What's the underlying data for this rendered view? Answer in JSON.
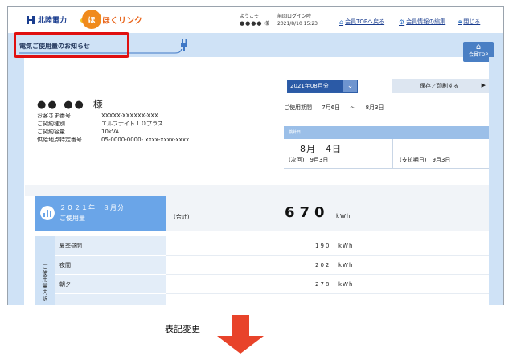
{
  "header": {
    "logo_company": "北陸電力",
    "logo_service": "ほくリンク",
    "welcome_label": "ようこそ",
    "user_name": "●●●●",
    "user_suffix": "様",
    "last_login_label": "前回ログイン時",
    "last_login_value": "2021/8/10 15:23",
    "links": [
      {
        "label": "会員TOPへ戻る",
        "icon": "home-icon"
      },
      {
        "label": "会員情報の編集",
        "icon": "gear-icon"
      },
      {
        "label": "閉じる",
        "icon": "lock-icon"
      }
    ]
  },
  "title_bar": {
    "title": "電気ご使用量のお知らせ",
    "top_button_label": "会員TOP"
  },
  "customer": {
    "name": "●● ●●",
    "honorific": "様",
    "fields": [
      {
        "key": "お客さま番号",
        "value": "XXXXX-XXXXXX-XXX"
      },
      {
        "key": "ご契約種別",
        "value": "エルフナイト１０プラス"
      },
      {
        "key": "ご契約容量",
        "value": "10kVA"
      },
      {
        "key": "供給地点特定番号",
        "value": "05-0000-0000- xxxx-xxxx-xxxx"
      }
    ]
  },
  "month_select": {
    "value": "2021年08月分"
  },
  "save_button": {
    "label": "保存／印刷する"
  },
  "period": {
    "label": "ご使用期間",
    "from": "7月6日",
    "sep": "～",
    "to": "8月3日"
  },
  "meter": {
    "header": "検針日",
    "date": "8月　4日",
    "next_label": "(次回)",
    "next_date": "9月3日",
    "pay_label": "(支払期日)",
    "pay_date": "9月3日"
  },
  "usage": {
    "month_line": "２０２１年　８月分",
    "label": "ご使用量",
    "total_label": "(合計)",
    "total_value": "670",
    "unit": "kWh",
    "breakdown_label": "ご使用量内訳",
    "rows": [
      {
        "name": "夏季昼間",
        "value": "190",
        "unit": "kWh"
      },
      {
        "name": "夜間",
        "value": "202",
        "unit": "kWh"
      },
      {
        "name": "朝夕",
        "value": "278",
        "unit": "kWh"
      }
    ]
  },
  "caption": "表記変更",
  "colors": {
    "accent": "#2e5ea8",
    "highlight": "#e01010",
    "arrow": "#e8432a"
  }
}
